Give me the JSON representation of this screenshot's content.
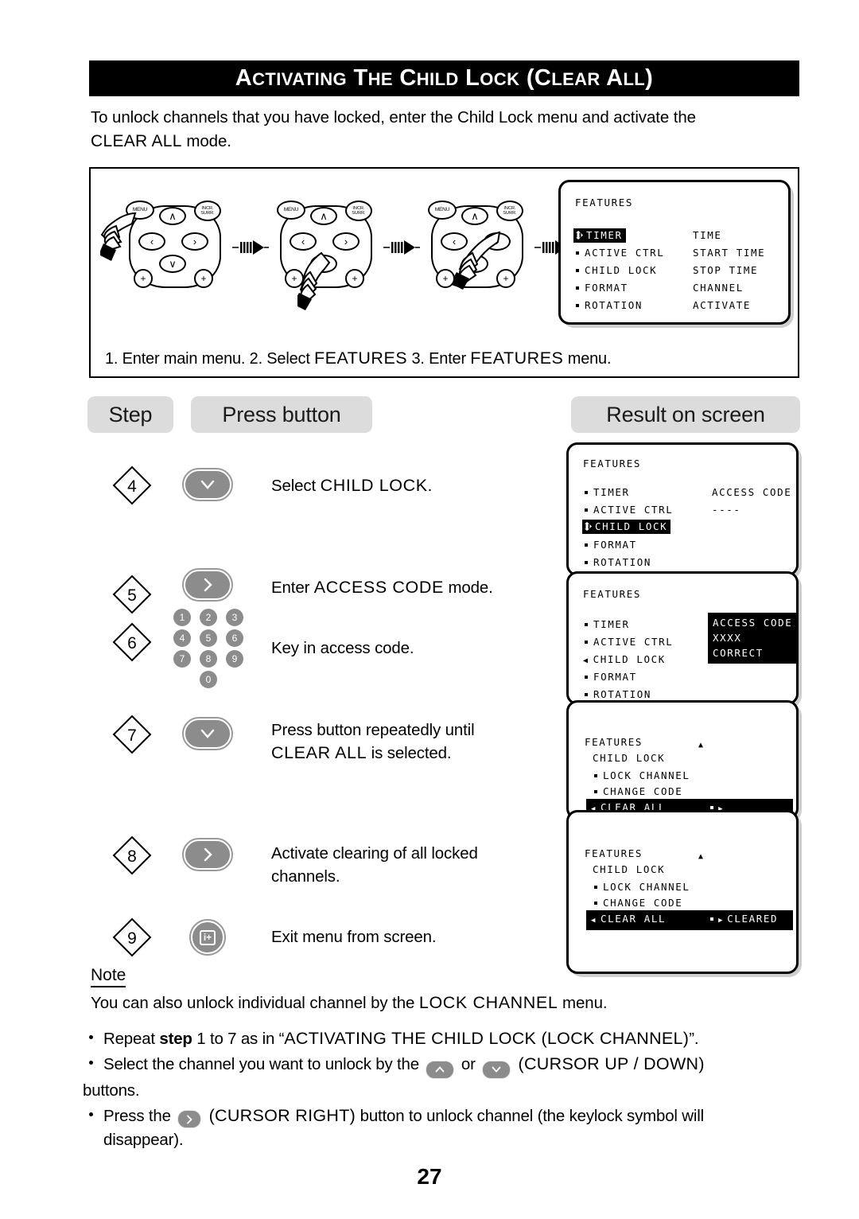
{
  "page": {
    "number": "27"
  },
  "header": {
    "title_parts": [
      {
        "t": "A",
        "small": false
      },
      {
        "t": "CTIVATING",
        "small": true
      },
      {
        "t": " T",
        "small": false
      },
      {
        "t": "HE",
        "small": true
      },
      {
        "t": " C",
        "small": false
      },
      {
        "t": "HILD",
        "small": true
      },
      {
        "t": " L",
        "small": false
      },
      {
        "t": "OCK",
        "small": true
      },
      {
        "t": " (C",
        "small": false
      },
      {
        "t": "LEAR",
        "small": true
      },
      {
        "t": " A",
        "small": false
      },
      {
        "t": "LL",
        "small": true
      },
      {
        "t": ")",
        "small": false
      }
    ],
    "title_plain": "ACTIVATING THE CHILD LOCK (CLEAR ALL)"
  },
  "intro": {
    "line1": "To unlock channels that you have locked, enter the Child Lock menu and activate the",
    "line2_caps": "CLEAR ALL",
    "line2_rest": " mode."
  },
  "diagram": {
    "caption": "1. Enter main menu.  2. Select FEATURES 3. Enter FEATURES menu.",
    "caption_parts": {
      "p1": "1. Enter main menu.  ",
      "p2": "2. Select ",
      "p3": "FEATURES",
      "p4": " 3. Enter ",
      "p5": "FEATURES",
      "p6": " menu."
    },
    "remotes": [
      {
        "id": "remote-1",
        "pressed": "MENU",
        "menu_label": "MENU",
        "incr_label_1": "INCR.",
        "incr_label_2": "SURR.",
        "up": "∧",
        "down": "∨",
        "left": "‹",
        "right": "›",
        "plus": "+"
      },
      {
        "id": "remote-2",
        "pressed": "DOWN",
        "menu_label": "MENU",
        "incr_label_1": "INCR.",
        "incr_label_2": "SURR.",
        "up": "∧",
        "down": "∨",
        "left": "‹",
        "right": "›",
        "plus": "+"
      },
      {
        "id": "remote-3",
        "pressed": "RIGHT",
        "menu_label": "MENU",
        "incr_label_1": "INCR.",
        "incr_label_2": "SURR.",
        "up": "∧",
        "down": "∨",
        "left": "‹",
        "right": "›",
        "plus": "+"
      }
    ],
    "osd": {
      "title": "FEATURES",
      "left_items": [
        "TIMER",
        "ACTIVE CTRL",
        "CHILD LOCK",
        "FORMAT",
        "ROTATION"
      ],
      "right_items": [
        "TIME",
        "START TIME",
        "STOP TIME",
        "CHANNEL",
        "ACTIVATE"
      ],
      "highlight_index": 0
    }
  },
  "columns": {
    "step": "Step",
    "press_button": "Press button",
    "result": "Result on screen"
  },
  "steps": [
    {
      "number": "4",
      "button": "cursor-down",
      "glyph": "∨",
      "text_pre": "Select ",
      "text_caps": "CHILD LOCK",
      "text_post": "."
    },
    {
      "number": "5",
      "button": "cursor-right",
      "glyph": "›",
      "text_pre": "Enter ",
      "text_caps": "ACCESS CODE",
      "text_post": " mode."
    },
    {
      "number": "6",
      "button": "numeric-keypad",
      "keys": [
        "1",
        "2",
        "3",
        "4",
        "5",
        "6",
        "7",
        "8",
        "9",
        "0"
      ],
      "text_pre": "Key in access code.",
      "text_caps": "",
      "text_post": ""
    },
    {
      "number": "7",
      "button": "cursor-down",
      "glyph": "∨",
      "text_line1": "Press button repeatedly until",
      "text_caps": "CLEAR ALL",
      "text_post": " is selected."
    },
    {
      "number": "8",
      "button": "cursor-right",
      "glyph": "›",
      "text_line1": "Activate clearing of all locked",
      "text_line2": "channels."
    },
    {
      "number": "9",
      "button": "info-plus",
      "glyph": "i+",
      "text_line1": "Exit menu from screen."
    }
  ],
  "results": [
    {
      "id": "result-screen-1",
      "title": "FEATURES",
      "left_items": [
        "TIMER",
        "ACTIVE CTRL",
        "CHILD LOCK",
        "FORMAT",
        "ROTATION"
      ],
      "highlight_index": 2,
      "right_title": "ACCESS CODE",
      "right_value": "----"
    },
    {
      "id": "result-screen-2",
      "title": "FEATURES",
      "left_items": [
        "TIMER",
        "ACTIVE CTRL",
        "CHILD LOCK",
        "FORMAT",
        "ROTATION"
      ],
      "highlight_index": -1,
      "marker_index": 2,
      "block_lines": [
        "ACCESS CODE",
        "XXXX",
        "CORRECT"
      ]
    },
    {
      "id": "result-screen-3",
      "title": "FEATURES",
      "subtitle": "CHILD LOCK",
      "items": [
        "LOCK CHANNEL",
        "CHANGE CODE",
        "CLEAR ALL"
      ],
      "highlight_index": 2,
      "highlight_right": "",
      "up_arrow": "▲"
    },
    {
      "id": "result-screen-4",
      "title": "FEATURES",
      "subtitle": "CHILD LOCK",
      "items": [
        "LOCK CHANNEL",
        "CHANGE CODE",
        "CLEAR ALL"
      ],
      "highlight_index": 2,
      "highlight_right": "CLEARED",
      "up_arrow": "▲"
    }
  ],
  "note": {
    "label": "Note",
    "body_pre": "You can also unlock individual channel by the ",
    "body_caps": "LOCK CHANNEL",
    "body_post": " menu.",
    "bullets": [
      {
        "pre": "Repeat ",
        "bold": "step",
        "mid": " 1 to 7 as in “",
        "caps": "ACTIVATING THE CHILD LOCK (LOCK CHANNEL)",
        "post": "”."
      },
      {
        "pre": "Select the channel you want to unlock by the ",
        "btn1": "∧",
        "mid": " or ",
        "btn2": "∨",
        "caps": " (CURSOR UP / DOWN)",
        "post": "",
        "cont": "buttons."
      },
      {
        "pre": "Press the ",
        "btn1": "›",
        "caps": " (CURSOR RIGHT)",
        "post": " button to unlock channel (the keylock symbol will",
        "cont": "disappear)."
      }
    ]
  },
  "colors": {
    "black": "#000000",
    "pill_grey": "#dcdcdc",
    "button_grey": "#8c8c8c",
    "shadow_grey": "#cfcfcf"
  }
}
